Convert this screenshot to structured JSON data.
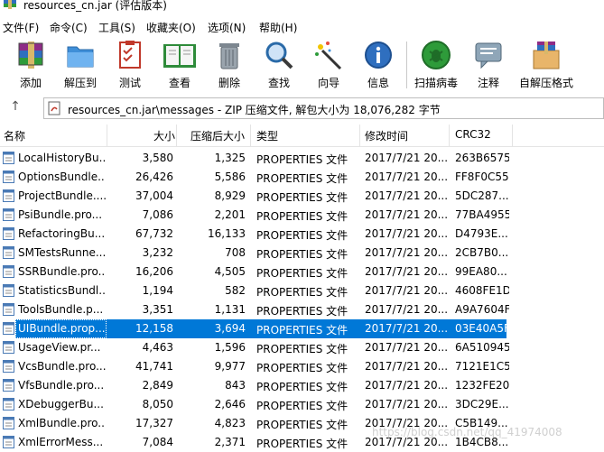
{
  "window": {
    "title": "resources_cn.jar (评估版本)"
  },
  "menu": [
    "文件(F)",
    "命令(C)",
    "工具(S)",
    "收藏夹(O)",
    "选项(N)",
    "帮助(H)"
  ],
  "toolbar": {
    "add": "添加",
    "extract_to": "解压到",
    "test": "测试",
    "view": "查看",
    "delete": "删除",
    "find": "查找",
    "wizard": "向导",
    "info": "信息",
    "virus_scan": "扫描病毒",
    "comment": "注释",
    "sfx": "自解压格式"
  },
  "address": {
    "path": "resources_cn.jar\\messages - ZIP 压缩文件, 解包大小为 18,076,282 字节"
  },
  "columns": {
    "name": "名称",
    "size": "大小",
    "packed": "压缩后大小",
    "type": "类型",
    "modified": "修改时间",
    "crc": "CRC32"
  },
  "rows": [
    {
      "name": "LocalHistoryBu...",
      "size": "3,580",
      "packed": "1,325",
      "type": "PROPERTIES 文件",
      "modified": "2017/7/21 20...",
      "crc": "263B6575"
    },
    {
      "name": "OptionsBundle...",
      "size": "26,426",
      "packed": "5,586",
      "type": "PROPERTIES 文件",
      "modified": "2017/7/21 20...",
      "crc": "FF8F0C55"
    },
    {
      "name": "ProjectBundle....",
      "size": "37,004",
      "packed": "8,929",
      "type": "PROPERTIES 文件",
      "modified": "2017/7/21 20...",
      "crc": "5DC287..."
    },
    {
      "name": "PsiBundle.pro...",
      "size": "7,086",
      "packed": "2,201",
      "type": "PROPERTIES 文件",
      "modified": "2017/7/21 20...",
      "crc": "77BA4955"
    },
    {
      "name": "RefactoringBu...",
      "size": "67,732",
      "packed": "16,133",
      "type": "PROPERTIES 文件",
      "modified": "2017/7/21 20...",
      "crc": "D4793E..."
    },
    {
      "name": "SMTestsRunne...",
      "size": "3,232",
      "packed": "708",
      "type": "PROPERTIES 文件",
      "modified": "2017/7/21 20...",
      "crc": "2CB7B0..."
    },
    {
      "name": "SSRBundle.pro...",
      "size": "16,206",
      "packed": "4,505",
      "type": "PROPERTIES 文件",
      "modified": "2017/7/21 20...",
      "crc": "99EA80..."
    },
    {
      "name": "StatisticsBundl...",
      "size": "1,194",
      "packed": "582",
      "type": "PROPERTIES 文件",
      "modified": "2017/7/21 20...",
      "crc": "4608FE1D"
    },
    {
      "name": "ToolsBundle.p...",
      "size": "3,351",
      "packed": "1,131",
      "type": "PROPERTIES 文件",
      "modified": "2017/7/21 20...",
      "crc": "A9A7604F"
    },
    {
      "name": "UIBundle.prop...",
      "size": "12,158",
      "packed": "3,694",
      "type": "PROPERTIES 文件",
      "modified": "2017/7/21 20...",
      "crc": "03E40A5F",
      "selected": true
    },
    {
      "name": "UsageView.pr...",
      "size": "4,463",
      "packed": "1,596",
      "type": "PROPERTIES 文件",
      "modified": "2017/7/21 20...",
      "crc": "6A510945"
    },
    {
      "name": "VcsBundle.pro...",
      "size": "41,741",
      "packed": "9,977",
      "type": "PROPERTIES 文件",
      "modified": "2017/7/21 20...",
      "crc": "7121E1C5"
    },
    {
      "name": "VfsBundle.pro...",
      "size": "2,849",
      "packed": "843",
      "type": "PROPERTIES 文件",
      "modified": "2017/7/21 20...",
      "crc": "1232FE20"
    },
    {
      "name": "XDebuggerBu...",
      "size": "8,050",
      "packed": "2,646",
      "type": "PROPERTIES 文件",
      "modified": "2017/7/21 20...",
      "crc": "3DC29E..."
    },
    {
      "name": "XmlBundle.pro...",
      "size": "17,327",
      "packed": "4,823",
      "type": "PROPERTIES 文件",
      "modified": "2017/7/21 20...",
      "crc": "C5B149..."
    },
    {
      "name": "XmlErrorMess...",
      "size": "7,084",
      "packed": "2,371",
      "type": "PROPERTIES 文件",
      "modified": "2017/7/21 20...",
      "crc": "1B4CB8..."
    }
  ],
  "watermark": "https://blog.csdn.net/qq_41974008",
  "colors": {
    "selection": "#0078d7",
    "border": "#bdbdbd"
  }
}
